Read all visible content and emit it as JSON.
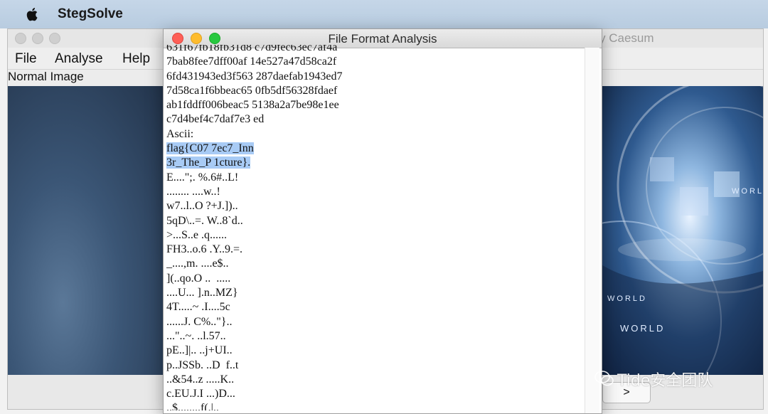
{
  "menubar": {
    "app_name": "StegSolve"
  },
  "main_window": {
    "title": "y Caesum",
    "menu": [
      "File",
      "Analyse",
      "Help"
    ],
    "image_label": "Normal Image",
    "next_label": ">",
    "world_labels": [
      "WORLD",
      "WORLD",
      "WORLD"
    ]
  },
  "dialog": {
    "title": "File Format Analysis",
    "lines": [
      "631f67fb18fb31d8 c7d9fec63ec7af4a",
      "7bab8fee7dff00af 14e527a47d58ca2f",
      "6fd431943ed3f563 287daefab1943ed7",
      "7d58ca1f6bbeac65 0fb5df56328fdaef",
      "ab1fddff006beac5 5138a2a7be98e1ee",
      "c7d4bef4c7daf7e3 ed",
      "Ascii:",
      "flag{C07 7ec7_Inn",
      "3r_The_P 1cture}.",
      "E....\";. %.6#..L!",
      "........ ....w..!",
      "w7..l..O ?+J.]).. ",
      "5qD\\..=. W..8`d..",
      ">...S..e .q......",
      "FH3..o.6 .Y..9.=.",
      "_....,m. ....e$..",
      "](..qo.O ..  .....",
      "....U... ].n..MZ}",
      "4T.....~ .I....5c",
      "......J. C%..\"}..",
      "...\"..~. ..l.57..",
      "pE..]|.. ..j+UI..",
      "p..JSSb. ..D  f..t",
      "..&54..z .....K..",
      "c.EU.J.I ...)D...",
      "..$........f(.|.."
    ],
    "selected_line_indices": [
      7,
      8
    ]
  },
  "watermark": {
    "text": "Tide安全团队"
  }
}
